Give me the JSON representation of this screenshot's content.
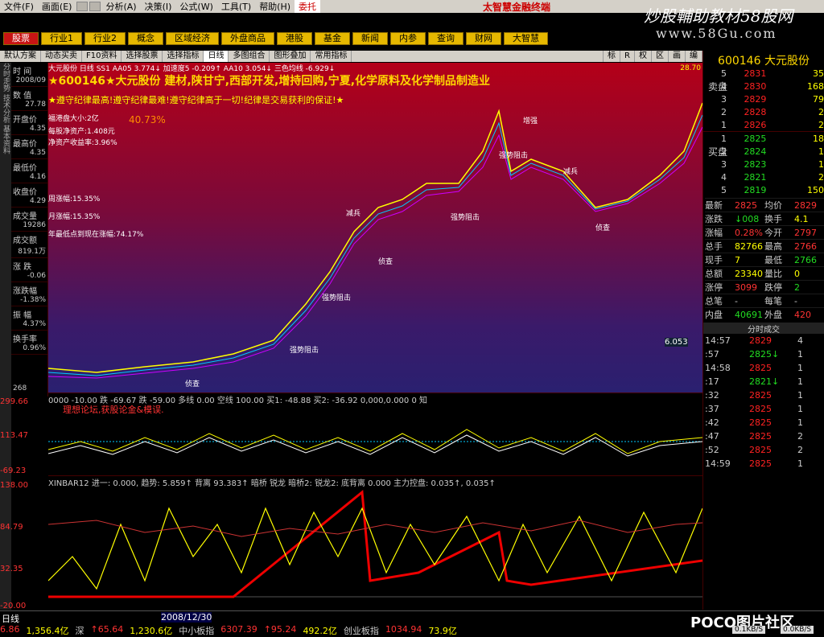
{
  "menu": [
    "文件(F)",
    "画面(E)",
    "分析(A)",
    "决策(I)",
    "公式(W)",
    "工具(T)",
    "帮助(H)",
    "委托"
  ],
  "brand": "太智慧金融终端",
  "watermark": {
    "line1": "炒股輔助教材58股网",
    "line2": "www.58Gu.com"
  },
  "nav_buttons": [
    "股票",
    "行业1",
    "行业2",
    "概念",
    "区域经济",
    "外盘商品",
    "港股",
    "基金",
    "新闻",
    "内参",
    "查询",
    "财网",
    "大智慧"
  ],
  "tabs": [
    "默认方案",
    "动态买卖",
    "F10资料",
    "选择股票",
    "选择指标",
    "日线",
    "多图组合",
    "图形叠加",
    "常用指标"
  ],
  "toolbar_extra": [
    "标",
    "R",
    "权",
    "区",
    "画",
    "编"
  ],
  "left_vertical": "分时走势 技术分析 基本资料",
  "info_panel": [
    {
      "k": "时 间",
      "v": "2008/09"
    },
    {
      "k": "数 值",
      "v": "27.78"
    },
    {
      "k": "开盘价",
      "v": "4.35"
    },
    {
      "k": "最高价",
      "v": "4.35"
    },
    {
      "k": "最低价",
      "v": "4.16"
    },
    {
      "k": "收盘价",
      "v": "4.29"
    },
    {
      "k": "成交量",
      "v": "19286"
    },
    {
      "k": "成交额",
      "v": "819.1万"
    },
    {
      "k": "涨 跌",
      "v": "-0.06"
    },
    {
      "k": "涨跌幅",
      "v": "-1.38%"
    },
    {
      "k": "振 幅",
      "v": "4.37%"
    },
    {
      "k": "换手率",
      "v": "0.96%"
    }
  ],
  "chart_header": "大元股份 日线 SS1 AA05 3.774↓ 加速度5 -0.209↑ AA10 3.054↓ 三色均线 -6.929↓",
  "stock_title": "★600146★大元股份 建材,陕甘宁,西部开发,增持回购,宁夏,化学原料及化学制品制造业",
  "banner": "★遵守纪律最高!遵守纪律最难!遵守纪律高于一切!纪律是交易获利的保证!★",
  "info_block": [
    "福港盘大小:2亿",
    "每股净资产:1.408元",
    "净资产收益率:3.96%",
    "周涨幅:15.35%",
    "月涨幅:15.35%",
    "年最低点到现在涨幅:74.17%"
  ],
  "pct_badge": "40.73%",
  "signals": [
    "强势阻击",
    "减兵",
    "侦查",
    "增强"
  ],
  "price_axis": {
    "top": "28.70",
    "mid": "6.053",
    "bottom": "268"
  },
  "mid_title": "0000 -10.00 跌 -69.67 跌 -59.00 多线 0.00 空线 100.00 买1: -48.88 买2: -36.92 0,000,0.000 0 知",
  "mid_sub": "理想论坛,获股论金&模误.",
  "mid_axis": {
    "top": "299.66",
    "mid": "113.47",
    "bottom": "-69.23"
  },
  "low_title": "XINBAR12 进一: 0.000, 趋势: 5.859↑ 背离 93.383↑ 暗桥 锐龙 暗桥2: 锐龙2: 底背离 0.000 主力控盘: 0.035↑, 0.035↑",
  "low_axis": {
    "top": "138.00",
    "a": "84.79",
    "b": "32.35",
    "c": "-20.00"
  },
  "status": {
    "tab": "日线",
    "date": "2008/12/30",
    "items": [
      "6.86",
      "1,356.4亿",
      "深",
      "↑65.64",
      "1,230.6亿",
      "中小板指",
      "6307.39",
      "↑95.24",
      "492.2亿",
      "创业板指",
      "1034.94",
      "73.9亿"
    ],
    "net": [
      "0.1KB/S",
      "0.0KB/S"
    ],
    "poco": "POCO图片社区"
  },
  "quote": {
    "code": "600146 大元股份",
    "side_sell": "卖盘",
    "side_buy": "买盘",
    "sells": [
      {
        "n": "5",
        "p": "2831",
        "q": "35"
      },
      {
        "n": "4",
        "p": "2830",
        "q": "168"
      },
      {
        "n": "3",
        "p": "2829",
        "q": "79"
      },
      {
        "n": "2",
        "p": "2828",
        "q": "2"
      },
      {
        "n": "1",
        "p": "2826",
        "q": "2"
      }
    ],
    "buys": [
      {
        "n": "1",
        "p": "2825",
        "q": "18"
      },
      {
        "n": "2",
        "p": "2824",
        "q": "1"
      },
      {
        "n": "3",
        "p": "2823",
        "q": "1"
      },
      {
        "n": "4",
        "p": "2821",
        "q": "2"
      },
      {
        "n": "5",
        "p": "2819",
        "q": "150"
      }
    ],
    "stats": [
      [
        "最新",
        "2825",
        "均价",
        "2829"
      ],
      [
        "涨跌",
        "↓008",
        "换手",
        "4.1"
      ],
      [
        "涨幅",
        "0.28%",
        "今开",
        "2797"
      ],
      [
        "总手",
        "82766",
        "最高",
        "2766"
      ],
      [
        "现手",
        "7",
        "最低",
        "2766"
      ],
      [
        "总额",
        "23340",
        "量比",
        "0"
      ],
      [
        "涨停",
        "3099",
        "跌停",
        "2"
      ],
      [
        "总笔",
        "-",
        "每笔",
        "-"
      ],
      [
        "内盘",
        "40691",
        "外盘",
        "420"
      ]
    ],
    "ticks_title": "分时成交",
    "ticks": [
      {
        "t": "14:57",
        "p": "2829",
        "v": "4"
      },
      {
        "t": ":57",
        "p": "2825↓",
        "v": "1"
      },
      {
        "t": "14:58",
        "p": "2825",
        "v": "1"
      },
      {
        "t": ":17",
        "p": "2821↓",
        "v": "1"
      },
      {
        "t": ":32",
        "p": "2825",
        "v": "1"
      },
      {
        "t": ":37",
        "p": "2825",
        "v": "1"
      },
      {
        "t": ":42",
        "p": "2825",
        "v": "1"
      },
      {
        "t": ":47",
        "p": "2825",
        "v": "2"
      },
      {
        "t": ":52",
        "p": "2825",
        "v": "2"
      },
      {
        "t": "14:59",
        "p": "2825",
        "v": "1"
      }
    ]
  }
}
